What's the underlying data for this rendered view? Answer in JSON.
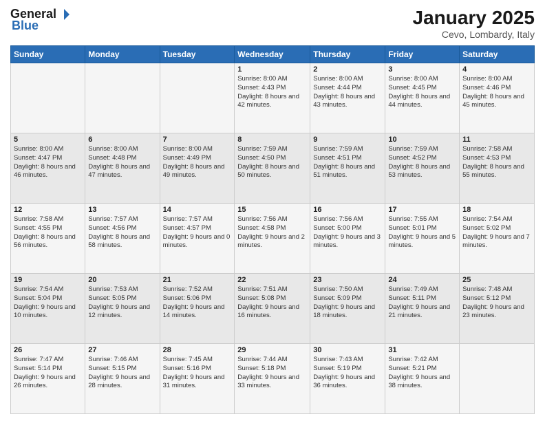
{
  "logo": {
    "general": "General",
    "blue": "Blue"
  },
  "title": "January 2025",
  "location": "Cevo, Lombardy, Italy",
  "days_header": [
    "Sunday",
    "Monday",
    "Tuesday",
    "Wednesday",
    "Thursday",
    "Friday",
    "Saturday"
  ],
  "weeks": [
    [
      {
        "day": "",
        "info": ""
      },
      {
        "day": "",
        "info": ""
      },
      {
        "day": "",
        "info": ""
      },
      {
        "day": "1",
        "info": "Sunrise: 8:00 AM\nSunset: 4:43 PM\nDaylight: 8 hours\nand 42 minutes."
      },
      {
        "day": "2",
        "info": "Sunrise: 8:00 AM\nSunset: 4:44 PM\nDaylight: 8 hours\nand 43 minutes."
      },
      {
        "day": "3",
        "info": "Sunrise: 8:00 AM\nSunset: 4:45 PM\nDaylight: 8 hours\nand 44 minutes."
      },
      {
        "day": "4",
        "info": "Sunrise: 8:00 AM\nSunset: 4:46 PM\nDaylight: 8 hours\nand 45 minutes."
      }
    ],
    [
      {
        "day": "5",
        "info": "Sunrise: 8:00 AM\nSunset: 4:47 PM\nDaylight: 8 hours\nand 46 minutes."
      },
      {
        "day": "6",
        "info": "Sunrise: 8:00 AM\nSunset: 4:48 PM\nDaylight: 8 hours\nand 47 minutes."
      },
      {
        "day": "7",
        "info": "Sunrise: 8:00 AM\nSunset: 4:49 PM\nDaylight: 8 hours\nand 49 minutes."
      },
      {
        "day": "8",
        "info": "Sunrise: 7:59 AM\nSunset: 4:50 PM\nDaylight: 8 hours\nand 50 minutes."
      },
      {
        "day": "9",
        "info": "Sunrise: 7:59 AM\nSunset: 4:51 PM\nDaylight: 8 hours\nand 51 minutes."
      },
      {
        "day": "10",
        "info": "Sunrise: 7:59 AM\nSunset: 4:52 PM\nDaylight: 8 hours\nand 53 minutes."
      },
      {
        "day": "11",
        "info": "Sunrise: 7:58 AM\nSunset: 4:53 PM\nDaylight: 8 hours\nand 55 minutes."
      }
    ],
    [
      {
        "day": "12",
        "info": "Sunrise: 7:58 AM\nSunset: 4:55 PM\nDaylight: 8 hours\nand 56 minutes."
      },
      {
        "day": "13",
        "info": "Sunrise: 7:57 AM\nSunset: 4:56 PM\nDaylight: 8 hours\nand 58 minutes."
      },
      {
        "day": "14",
        "info": "Sunrise: 7:57 AM\nSunset: 4:57 PM\nDaylight: 9 hours\nand 0 minutes."
      },
      {
        "day": "15",
        "info": "Sunrise: 7:56 AM\nSunset: 4:58 PM\nDaylight: 9 hours\nand 2 minutes."
      },
      {
        "day": "16",
        "info": "Sunrise: 7:56 AM\nSunset: 5:00 PM\nDaylight: 9 hours\nand 3 minutes."
      },
      {
        "day": "17",
        "info": "Sunrise: 7:55 AM\nSunset: 5:01 PM\nDaylight: 9 hours\nand 5 minutes."
      },
      {
        "day": "18",
        "info": "Sunrise: 7:54 AM\nSunset: 5:02 PM\nDaylight: 9 hours\nand 7 minutes."
      }
    ],
    [
      {
        "day": "19",
        "info": "Sunrise: 7:54 AM\nSunset: 5:04 PM\nDaylight: 9 hours\nand 10 minutes."
      },
      {
        "day": "20",
        "info": "Sunrise: 7:53 AM\nSunset: 5:05 PM\nDaylight: 9 hours\nand 12 minutes."
      },
      {
        "day": "21",
        "info": "Sunrise: 7:52 AM\nSunset: 5:06 PM\nDaylight: 9 hours\nand 14 minutes."
      },
      {
        "day": "22",
        "info": "Sunrise: 7:51 AM\nSunset: 5:08 PM\nDaylight: 9 hours\nand 16 minutes."
      },
      {
        "day": "23",
        "info": "Sunrise: 7:50 AM\nSunset: 5:09 PM\nDaylight: 9 hours\nand 18 minutes."
      },
      {
        "day": "24",
        "info": "Sunrise: 7:49 AM\nSunset: 5:11 PM\nDaylight: 9 hours\nand 21 minutes."
      },
      {
        "day": "25",
        "info": "Sunrise: 7:48 AM\nSunset: 5:12 PM\nDaylight: 9 hours\nand 23 minutes."
      }
    ],
    [
      {
        "day": "26",
        "info": "Sunrise: 7:47 AM\nSunset: 5:14 PM\nDaylight: 9 hours\nand 26 minutes."
      },
      {
        "day": "27",
        "info": "Sunrise: 7:46 AM\nSunset: 5:15 PM\nDaylight: 9 hours\nand 28 minutes."
      },
      {
        "day": "28",
        "info": "Sunrise: 7:45 AM\nSunset: 5:16 PM\nDaylight: 9 hours\nand 31 minutes."
      },
      {
        "day": "29",
        "info": "Sunrise: 7:44 AM\nSunset: 5:18 PM\nDaylight: 9 hours\nand 33 minutes."
      },
      {
        "day": "30",
        "info": "Sunrise: 7:43 AM\nSunset: 5:19 PM\nDaylight: 9 hours\nand 36 minutes."
      },
      {
        "day": "31",
        "info": "Sunrise: 7:42 AM\nSunset: 5:21 PM\nDaylight: 9 hours\nand 38 minutes."
      },
      {
        "day": "",
        "info": ""
      }
    ]
  ]
}
